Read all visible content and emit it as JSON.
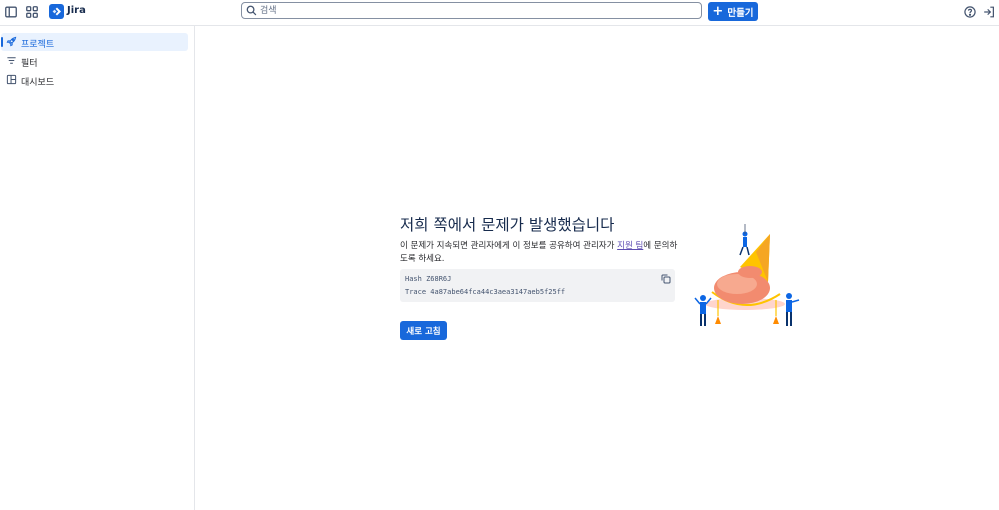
{
  "header": {
    "brand": "Jira",
    "search_placeholder": "검색",
    "create_label": "만들기",
    "create_plus": "+",
    "icons": [
      "sidebar-toggle-icon",
      "app-switcher-icon",
      "jira-logo-icon",
      "search-icon",
      "help-icon",
      "sign-out-icon"
    ]
  },
  "sidebar": {
    "items": [
      {
        "label": "프로젝트",
        "icon": "rocket-icon",
        "active": true
      },
      {
        "label": "필터",
        "icon": "filter-icon",
        "active": false
      },
      {
        "label": "대시보드",
        "icon": "dashboard-icon",
        "active": false
      }
    ]
  },
  "error": {
    "title": "저희 쪽에서 문제가 발생했습니다",
    "description_before": "이 문제가 지속되면 관리자에게 이 정보를 공유하여 관리자가 ",
    "support_link": "지원 팀",
    "description_after": "에 문의하도록 하세요.",
    "hash": "Hash Z68R6J",
    "trace": "Trace 4a87abe64fca44c3aea3147aeb5f25ff",
    "refresh_label": "새로 고침"
  },
  "colors": {
    "primary": "#1868db",
    "active_bg": "#e9f2fe",
    "code_bg": "#f1f2f4",
    "link": "#5e4db2"
  }
}
